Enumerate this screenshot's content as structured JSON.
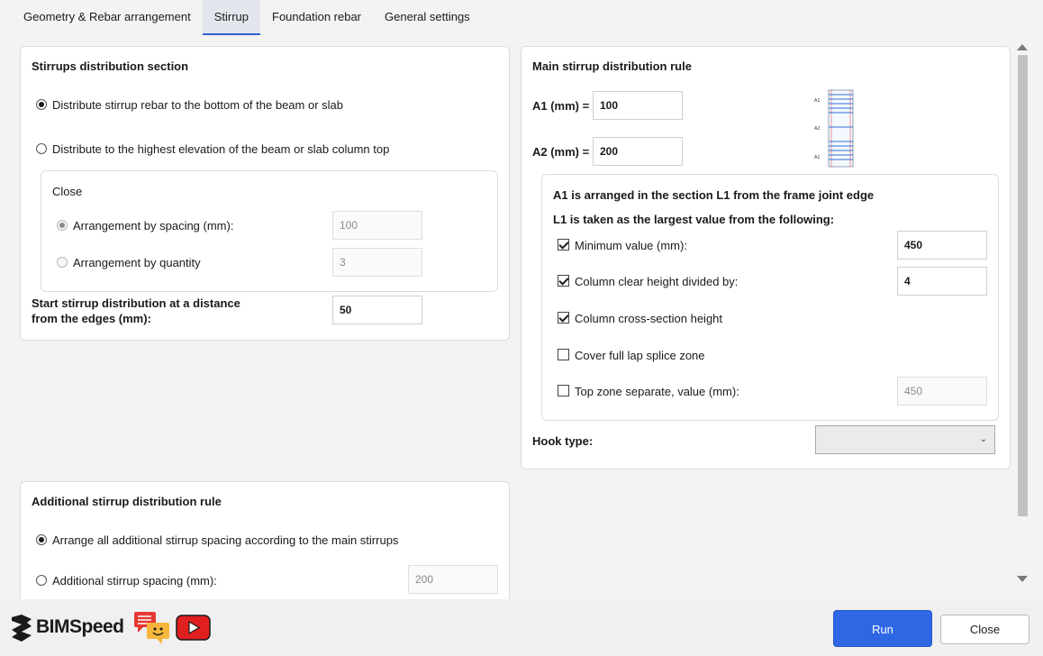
{
  "tabs": [
    {
      "label": "Geometry & Rebar arrangement"
    },
    {
      "label": "Stirrup"
    },
    {
      "label": "Foundation rebar"
    },
    {
      "label": "General settings"
    }
  ],
  "stirrups_section": {
    "title": "Stirrups distribution section",
    "option_bottom": "Distribute stirrup rebar to the bottom of the beam or slab",
    "option_highest": "Distribute to the highest elevation of the beam or slab column top",
    "close_group": {
      "title": "Close",
      "spacing_label": "Arrangement by spacing (mm):",
      "spacing_value": "100",
      "quantity_label": "Arrangement by quantity",
      "quantity_value": "3"
    },
    "start_label_line1": "Start stirrup distribution at a distance",
    "start_label_line2": "from the edges (mm):",
    "start_value": "50"
  },
  "main_rule": {
    "title": "Main stirrup distribution rule",
    "a1_label": "A1 (mm)  =",
    "a1_value": "100",
    "a2_label": "A2 (mm)  =",
    "a2_value": "200",
    "diagram_labels": {
      "top": "A1",
      "mid": "A2",
      "bottom": "A1"
    },
    "l1_group": {
      "title": "A1 is arranged in the section L1 from the frame joint edge",
      "subtitle": "L1 is taken as the largest value from the following:",
      "min_label": "Minimum value (mm):",
      "min_value": "450",
      "min_checked": true,
      "clear_height_label": "Column clear height divided by:",
      "clear_height_value": "4",
      "clear_height_checked": true,
      "cross_section_label": "Column cross-section height",
      "cross_section_checked": true,
      "lap_splice_label": "Cover full lap splice zone",
      "lap_splice_checked": false,
      "top_zone_label": "Top zone separate, value (mm):",
      "top_zone_value": "450",
      "top_zone_checked": false
    },
    "hook_label": "Hook type:",
    "hook_value": ""
  },
  "additional_rule": {
    "title": "Additional stirrup distribution rule",
    "option_main": "Arrange all additional stirrup spacing according to the main stirrups",
    "option_spacing": "Additional stirrup spacing (mm):",
    "spacing_value": "200"
  },
  "footer": {
    "brand": "BIMSpeed",
    "run_label": "Run",
    "close_label": "Close"
  },
  "colors": {
    "accent": "#2e67e4",
    "tab_active_underline": "#2f5fd0",
    "youtube_red": "#e01f1f",
    "chat_red": "#e53935",
    "chat_yellow": "#f5b73b"
  }
}
